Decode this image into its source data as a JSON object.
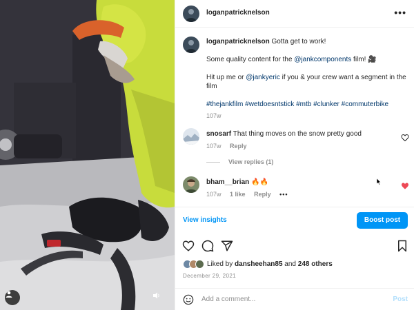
{
  "post": {
    "username": "loganpatricknelson",
    "caption": {
      "username": "loganpatricknelson",
      "line1": "Gotta get to work!",
      "line2_pre": "Some quality content for the ",
      "line2_mention": "@jankcomponents",
      "line2_post": " film! 🎥",
      "line3_pre": "Hit up me or ",
      "line3_mention": "@jankyeric",
      "line3_post": " if you & your crew want a segment in the film",
      "hashtags": "#thejankfilm #wetdoesntstick #mtb #clunker #commuterbike",
      "age": "107w"
    }
  },
  "comments": [
    {
      "username": "snosarf",
      "text": "That thing moves on the snow pretty good",
      "age": "107w",
      "reply_label": "Reply",
      "view_replies": "View replies (1)",
      "liked": false
    },
    {
      "username": "bham__brian",
      "text": "🔥🔥",
      "age": "107w",
      "likes": "1 like",
      "reply_label": "Reply",
      "liked": true
    }
  ],
  "insights": {
    "view_label": "View insights",
    "boost_label": "Boost post"
  },
  "likes": {
    "prefix": "Liked by ",
    "user": "dansheehan85",
    "suffix": " and ",
    "others": "248 others"
  },
  "date": "December 29, 2021",
  "composer": {
    "placeholder": "Add a comment...",
    "post_label": "Post"
  },
  "more_glyph": "•••",
  "colors": {
    "accent": "#0095f6",
    "like_red": "#ed4956",
    "muted": "#8e8e8e",
    "mention": "#00376b"
  },
  "icons": [
    "tag-user-icon",
    "volume-icon",
    "more-options-icon",
    "heart-icon",
    "comment-icon",
    "share-icon",
    "bookmark-icon",
    "emoji-icon"
  ]
}
